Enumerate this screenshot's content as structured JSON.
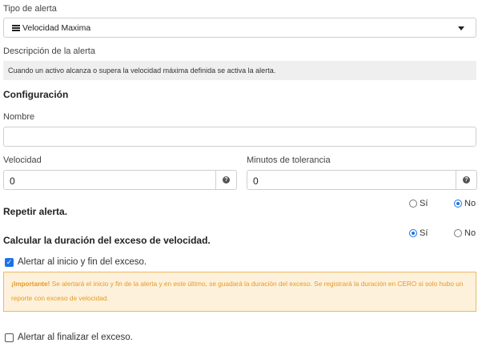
{
  "alert_type": {
    "label": "Tipo de alerta",
    "selected": "Velocidad Maxima",
    "icon": "list-icon"
  },
  "description": {
    "label": "Descripción de la alerta",
    "text": "Cuando un activo alcanza o supera la velocidad máxima definida se activa la alerta."
  },
  "config": {
    "heading": "Configuración",
    "name_label": "Nombre",
    "name_value": "",
    "speed_label": "Velocidad",
    "speed_value": "0",
    "tolerance_label": "Minutos de tolerancia",
    "tolerance_value": "0"
  },
  "repeat": {
    "label": "Repetir alerta.",
    "yes": "Sí",
    "no": "No",
    "selected": "No"
  },
  "calculate": {
    "label": "Calcular la duración del exceso de velocidad.",
    "yes": "Sí",
    "no": "No",
    "selected": "Sí"
  },
  "alert_start_end": {
    "label": "Alertar al inicio y fin del exceso.",
    "checked": true
  },
  "warning": {
    "bold": "¡Importante!",
    "text": " Se alertará el inicio y fin de la alerta y en este último, se guadará la duración del exceso. Se registrará la duración en CERO si solo hubo un reporte con exceso de velocidad."
  },
  "alert_end": {
    "label": "Alertar al finalizar el exceso.",
    "checked": false
  },
  "colors": {
    "accent": "#1a73e8",
    "warning_bg": "#fdf1dc",
    "warning_border": "#f0b860",
    "warning_text": "#e79a22"
  }
}
